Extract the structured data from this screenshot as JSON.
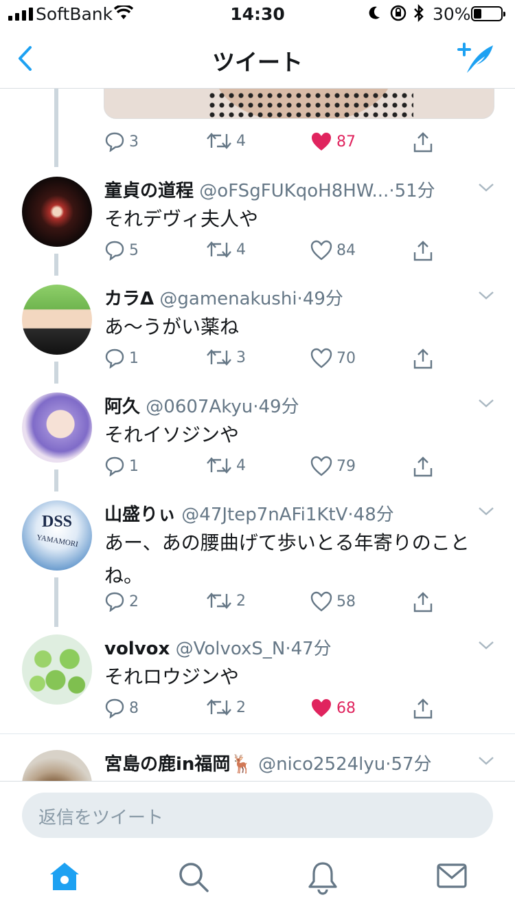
{
  "status_bar": {
    "carrier": "SoftBank",
    "time": "14:30",
    "battery": "30%"
  },
  "nav": {
    "title": "ツイート"
  },
  "thread_top": {
    "reply_count": "3",
    "retweet_count": "4",
    "like_count": "87"
  },
  "tweets": [
    {
      "name": "童貞の道程",
      "handle": "@oFSgFUKqoH8HW...",
      "time": "51分",
      "text": "それデヴィ夫人や",
      "replies": "5",
      "retweets": "4",
      "likes": "84",
      "liked": false
    },
    {
      "name": "カラΔ",
      "handle": "@gamenakushi",
      "time": "49分",
      "text": "あ〜うがい薬ね",
      "replies": "1",
      "retweets": "3",
      "likes": "70",
      "liked": false
    },
    {
      "name": "阿久",
      "handle": "@0607Akyu",
      "time": "49分",
      "text": "それイソジンや",
      "replies": "1",
      "retweets": "4",
      "likes": "79",
      "liked": false
    },
    {
      "name": "山盛りぃ",
      "handle": "@47Jtep7nAFi1KtV",
      "time": "48分",
      "text": "あー、あの腰曲げて歩いとる年寄りのことね。",
      "replies": "2",
      "retweets": "2",
      "likes": "58",
      "liked": false,
      "avatar_text": [
        "DSS",
        "YAMAMORI"
      ]
    },
    {
      "name": "volvox",
      "handle": "@VolvoxS_N",
      "time": "47分",
      "text": "それロウジンや",
      "replies": "8",
      "retweets": "2",
      "likes": "68",
      "liked": true
    },
    {
      "name": "宮島の鹿in福岡",
      "emoji": "🦌",
      "handle": "@nico2524lyu",
      "time": "57分"
    }
  ],
  "reply_input": {
    "placeholder": "返信をツイート"
  },
  "tabbar": [
    "home-icon",
    "search-icon",
    "notifications-icon",
    "messages-icon"
  ],
  "colors": {
    "accent": "#1da1f2",
    "like": "#e0245e",
    "secondary_text": "#657786"
  }
}
